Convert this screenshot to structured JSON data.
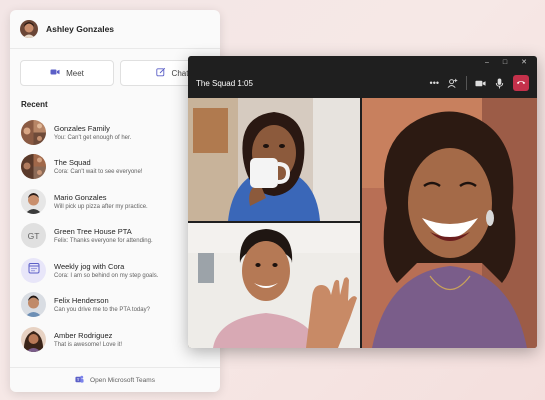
{
  "chat_panel": {
    "user_name": "Ashley Gonzales",
    "meet_label": "Meet",
    "chat_label": "Chat",
    "section_title": "Recent",
    "items": [
      {
        "name": "Gonzales Family",
        "preview": "You: Can't get enough of her."
      },
      {
        "name": "The Squad",
        "preview": "Cora: Can't wait to see everyone!"
      },
      {
        "name": "Mario Gonzales",
        "preview": "Will pick up pizza after my practice."
      },
      {
        "name": "Green Tree House PTA",
        "preview": "Felix: Thanks everyone for attending.",
        "initials": "GT"
      },
      {
        "name": "Weekly jog with Cora",
        "preview": "Cora: I am so behind on my step goals."
      },
      {
        "name": "Felix Henderson",
        "preview": "Can you drive me to the PTA today?"
      },
      {
        "name": "Amber Rodriguez",
        "preview": "That is awesome! Love it!"
      }
    ],
    "footer_label": "Open Microsoft Teams"
  },
  "call_window": {
    "title": "The Squad 1:05",
    "titlebar_icons": [
      "minimize-icon",
      "maximize-icon",
      "close-icon"
    ],
    "controls": [
      "more-icon",
      "add-people-icon",
      "camera-icon",
      "microphone-icon",
      "hangup-icon"
    ],
    "participants": [
      "participant-mug",
      "participant-waving",
      "participant-laughing"
    ]
  },
  "colors": {
    "accent": "#5b5fc7",
    "hangup": "#c4314b",
    "call_background": "#1f1f1f"
  }
}
